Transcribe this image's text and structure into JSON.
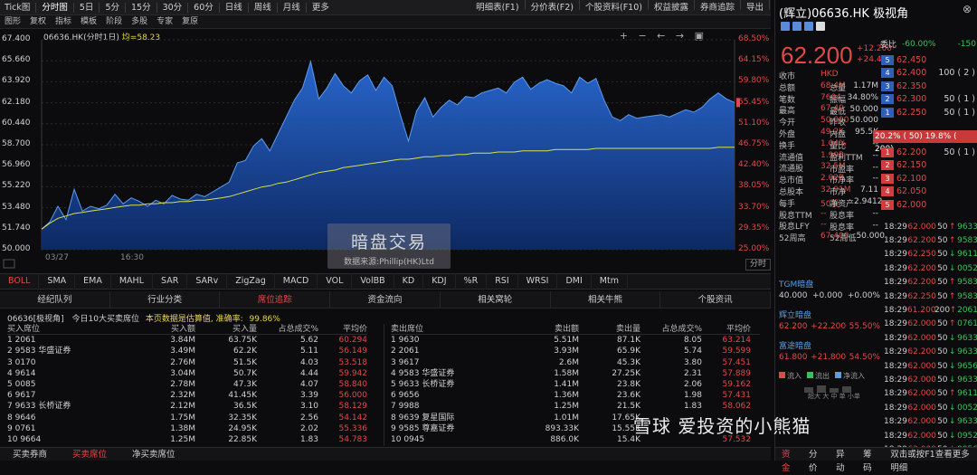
{
  "menu": {
    "left": [
      "Tick图",
      "分时图",
      "5日",
      "5分",
      "15分",
      "30分",
      "60分",
      "日线",
      "周线",
      "月线",
      "更多"
    ],
    "selected": "分时图",
    "right": [
      "明细表(F1)",
      "分价表(F2)",
      "个股资料(F10)",
      "权益披露",
      "券商追踪",
      "导出"
    ]
  },
  "toolbar2": [
    "图形",
    "复权",
    "指标",
    "模板",
    "阶段",
    "多股",
    "专家",
    "复原"
  ],
  "chart": {
    "title_prefix": "06636.HK(分时1日)",
    "avg_label": "均=58.23",
    "y_left": [
      "67.400",
      "65.660",
      "63.920",
      "62.180",
      "60.440",
      "58.700",
      "56.960",
      "55.220",
      "53.480",
      "51.740",
      "50.000"
    ],
    "y_right": [
      "68.50%",
      "64.15%",
      "59.80%",
      "55.45%",
      "51.10%",
      "46.75%",
      "42.40%",
      "38.05%",
      "33.70%",
      "29.35%",
      "25.00%"
    ],
    "x_labels": [
      "03/27",
      "16:30"
    ],
    "bottom_button": "分时",
    "tools": "+ − ← → ▣"
  },
  "chart_data": {
    "type": "area",
    "ylim": [
      50.0,
      67.4
    ],
    "series": [
      {
        "values": [
          51.7,
          52.3,
          53.6,
          52.5,
          55.0,
          53.2,
          53.6,
          53.4,
          53.7,
          54.6,
          53.8,
          54.3,
          54.0,
          53.6,
          54.1,
          53.8,
          54.5,
          54.2,
          54.1,
          54.6,
          54.4,
          54.8,
          55.2,
          55.6,
          57.2,
          57.4,
          58.6,
          59.2,
          58.2,
          59.6,
          61.0,
          62.4,
          63.4,
          65.6,
          62.5,
          63.4,
          64.6,
          63.6,
          63.0,
          64.0,
          64.5,
          63.2,
          64.3,
          63.6,
          61.2,
          59.0,
          61.5,
          62.6,
          61.0,
          61.8,
          62.4,
          62.0,
          62.7,
          62.6,
          63.0,
          63.2,
          63.4,
          63.0,
          63.9,
          64.3,
          63.3,
          63.8,
          64.1,
          63.8,
          63.6,
          63.0,
          64.3,
          63.8,
          64.2,
          62.4,
          61.0,
          60.7,
          61.2,
          60.9,
          61.0,
          61.1,
          61.2,
          61.0,
          61.3,
          61.6,
          61.4,
          61.8,
          62.5,
          63.0,
          62.5,
          62.2
        ]
      },
      {
        "name": "均",
        "values": [
          51.7,
          52.2,
          52.6,
          52.8,
          53.0,
          53.1,
          53.2,
          53.3,
          53.4,
          53.5,
          53.6,
          53.7,
          53.7,
          53.8,
          53.8,
          53.9,
          53.9,
          54.0,
          54.0,
          54.1,
          54.1,
          54.2,
          54.3,
          54.4,
          54.6,
          54.8,
          55.0,
          55.2,
          55.3,
          55.5,
          55.6,
          55.8,
          56.0,
          56.2,
          56.4,
          56.5,
          56.6,
          56.8,
          56.9,
          57.0,
          57.1,
          57.2,
          57.3,
          57.4,
          57.5,
          57.5,
          57.6,
          57.7,
          57.7,
          57.8,
          57.8,
          57.9,
          57.9,
          58.0,
          58.0,
          58.0,
          58.1,
          58.1,
          58.1,
          58.2,
          58.2,
          58.2,
          58.2,
          58.3,
          58.3,
          58.3,
          58.3,
          58.3,
          58.4,
          58.4,
          58.4,
          58.4,
          58.4,
          58.4,
          58.4,
          58.4,
          58.4,
          58.4,
          58.4,
          58.4,
          58.4,
          58.4,
          58.4,
          58.5,
          58.5,
          58.5
        ]
      }
    ]
  },
  "watermark": {
    "big": "暗盘交易",
    "small": "数据来源:Phillip(HK)Ltd"
  },
  "indicators": [
    "BOLL",
    "SMA",
    "EMA",
    "MAHL",
    "SAR",
    "SARv",
    "ZigZag",
    "MACD",
    "VOL",
    "VolBB",
    "KD",
    "KDJ",
    "%R",
    "RSI",
    "WRSI",
    "DMI",
    "Mtm"
  ],
  "indicator_selected": "BOLL",
  "bottom_tabs": [
    "经纪队列",
    "行业分类",
    "席位追踪",
    "资金流向",
    "相关窝轮",
    "相关牛熊",
    "个股资讯"
  ],
  "bottom_tab_selected": "席位追踪",
  "info": {
    "code": "06636[极视角]",
    "desc": "今日10大买卖席位",
    "note": "本页数据是估算值, 准确率:",
    "accuracy": "99.86%"
  },
  "buy": {
    "headers": [
      "买入席位",
      "买入额",
      "买入量",
      "占总成交%",
      "平均价"
    ],
    "rows": [
      [
        "1  2061",
        "3.84M",
        "63.75K",
        "5.62",
        "60.294"
      ],
      [
        "2  9583  华盛证券",
        "3.49M",
        "62.2K",
        "5.11",
        "56.149"
      ],
      [
        "3  0170",
        "2.76M",
        "51.5K",
        "4.03",
        "53.518"
      ],
      [
        "4  9614",
        "3.04M",
        "50.7K",
        "4.44",
        "59.942"
      ],
      [
        "5  0085",
        "2.78M",
        "47.3K",
        "4.07",
        "58.840"
      ],
      [
        "6  9617",
        "2.32M",
        "41.45K",
        "3.39",
        "56.000"
      ],
      [
        "7  9633  长桥证券",
        "2.12M",
        "36.5K",
        "3.10",
        "58.129"
      ],
      [
        "8  9646",
        "1.75M",
        "32.35K",
        "2.56",
        "54.142"
      ],
      [
        "9  0761",
        "1.38M",
        "24.95K",
        "2.02",
        "55.336"
      ],
      [
        "10  9664",
        "1.25M",
        "22.85K",
        "1.83",
        "54.783"
      ]
    ]
  },
  "sell": {
    "headers": [
      "卖出席位",
      "卖出额",
      "卖出量",
      "占总成交%",
      "平均价"
    ],
    "rows": [
      [
        "1  9630",
        "5.51M",
        "87.1K",
        "8.05",
        "63.214"
      ],
      [
        "2  2061",
        "3.93M",
        "65.9K",
        "5.74",
        "59.599"
      ],
      [
        "3  9617",
        "2.6M",
        "45.3K",
        "3.80",
        "57.451"
      ],
      [
        "4  9583  华盛证券",
        "1.58M",
        "27.25K",
        "2.31",
        "57.889"
      ],
      [
        "5  9633  长桥证券",
        "1.41M",
        "23.8K",
        "2.06",
        "59.162"
      ],
      [
        "6  9656",
        "1.36M",
        "23.6K",
        "1.98",
        "57.431"
      ],
      [
        "7  9988",
        "1.25M",
        "21.5K",
        "1.83",
        "58.062"
      ],
      [
        "8  9639  复星国际",
        "1.01M",
        "17.65K",
        "",
        ""
      ],
      [
        "9  9585  尊嘉证券",
        "893.33K",
        "15.55K",
        "",
        ""
      ],
      [
        "10  0945",
        "886.0K",
        "15.4K",
        "",
        "57.532"
      ]
    ]
  },
  "footer_tabs": [
    "买卖券商",
    "买卖席位",
    "净买卖席位"
  ],
  "footer_selected": "买卖席位",
  "right": {
    "title": "(辉立)06636.HK  极视角",
    "price": "62.200",
    "price_sub": [
      "+12.200",
      "+24.40%"
    ],
    "stats_left": [
      [
        "收市",
        "HKD"
      ],
      [
        "总额",
        "68.4M"
      ],
      [
        "笔数",
        "7604"
      ],
      [
        "最高",
        "67.40"
      ],
      [
        "今开",
        "50.000"
      ],
      [
        "外盘",
        "49.2K"
      ],
      [
        "换手",
        "1.04%"
      ],
      [
        "流通值",
        "1.99B"
      ],
      [
        "流通股",
        "32.5M"
      ],
      [
        "总市值",
        "2.02B"
      ],
      [
        "总股本",
        "32.91M"
      ],
      [
        "每手",
        "50股"
      ],
      [
        "股息TTM",
        "--"
      ],
      [
        "股息LFY",
        "--"
      ],
      [
        "52周高",
        "67.400"
      ]
    ],
    "stats_mid": [
      [
        "总量",
        "1.17M"
      ],
      [
        "振幅",
        "34.80%"
      ],
      [
        "最低",
        "50.000"
      ],
      [
        "昨收",
        "50.000"
      ],
      [
        "内盘",
        "95.5K"
      ],
      [
        "量比",
        "--"
      ],
      [
        "盈利TTM",
        "--"
      ],
      [
        "市盈率",
        "--"
      ],
      [
        "市净率",
        "--"
      ],
      [
        "市净",
        "7.11"
      ],
      [
        "净资产",
        "2.9412"
      ],
      [
        "股息率",
        "--"
      ],
      [
        "股息率",
        "--"
      ],
      [
        "52周低",
        "50.000"
      ]
    ],
    "ob_head": [
      "委比",
      "-60.00%",
      "-150"
    ],
    "asks": [
      [
        "5",
        "62.450",
        ""
      ],
      [
        "4",
        "62.400",
        "100 ( 2 )"
      ],
      [
        "3",
        "62.350",
        ""
      ],
      [
        "2",
        "62.300",
        "50 ( 1 )"
      ],
      [
        "1",
        "62.250",
        "50 ( 1 )"
      ]
    ],
    "ob_mid": "20.2% (  50) 19.8% ( 200)",
    "bids": [
      [
        "1",
        "62.200",
        "50 ( 1 )"
      ],
      [
        "2",
        "62.150",
        ""
      ],
      [
        "3",
        "62.100",
        ""
      ],
      [
        "4",
        "62.050",
        ""
      ],
      [
        "5",
        "62.000",
        ""
      ]
    ],
    "ticks": [
      [
        "18:29",
        "62.000",
        "50",
        "up",
        "9633"
      ],
      [
        "18:29",
        "62.200",
        "50",
        "up",
        "9583"
      ],
      [
        "18:29",
        "62.250",
        "50",
        "dn",
        "9611"
      ],
      [
        "18:29",
        "62.200",
        "50",
        "dn",
        "0052"
      ],
      [
        "18:29",
        "62.200",
        "50",
        "up",
        "9583"
      ],
      [
        "18:29",
        "62.250",
        "50",
        "up",
        "9583"
      ],
      [
        "18:29",
        "61.200",
        "200",
        "up",
        "2061"
      ],
      [
        "18:29",
        "62.000",
        "50",
        "up",
        "0761"
      ],
      [
        "18:29",
        "62.000",
        "50",
        "dn",
        "9633"
      ],
      [
        "18:29",
        "62.200",
        "50",
        "dn",
        "9633"
      ],
      [
        "18:29",
        "62.000",
        "50",
        "dn",
        "9656"
      ],
      [
        "18:29",
        "62.000",
        "50",
        "dn",
        "9633"
      ],
      [
        "18:29",
        "62.000",
        "50",
        "up",
        "9611"
      ],
      [
        "18:29",
        "62.000",
        "50",
        "dn",
        "0052"
      ],
      [
        "18:29",
        "62.000",
        "50",
        "dn",
        "9633"
      ],
      [
        "18:29",
        "62.000",
        "50",
        "dn",
        "0952"
      ],
      [
        "18:29",
        "62.000",
        "50",
        "dn",
        "9956"
      ]
    ],
    "dark_pools": [
      {
        "name": "TGM暗盘",
        "vals": [
          "40.000",
          "+0.000",
          "+0.00%"
        ]
      },
      {
        "name": "辉立暗盘",
        "vals": [
          "62.200",
          "+22.200",
          "55.50%"
        ]
      },
      {
        "name": "富途暗盘",
        "vals": [
          "61.800",
          "+21.800",
          "54.50%"
        ]
      }
    ],
    "legend": [
      "流入",
      "流出",
      "净流入"
    ],
    "mini_label": "超大 大 中 单 小单",
    "footer_tabs": [
      "资金",
      "分价",
      "异动",
      "筹码"
    ],
    "footer_hint": "双击或按F1查看更多明细"
  },
  "overlay_text": "雪球  爱投资的小熊猫"
}
